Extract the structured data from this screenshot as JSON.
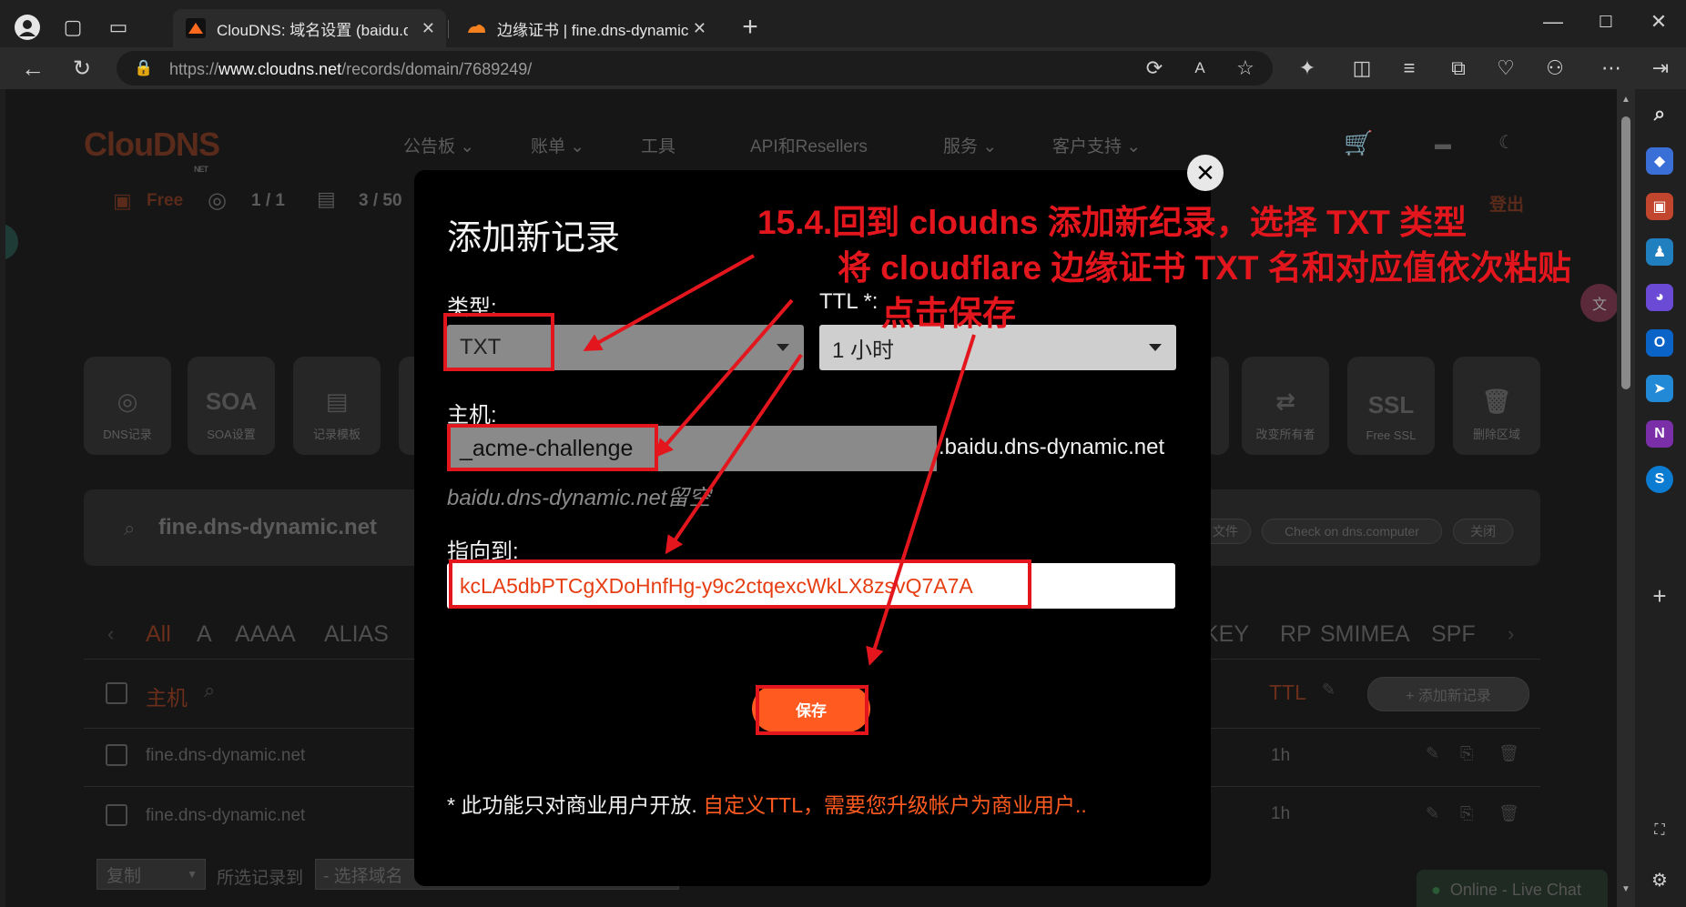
{
  "browser": {
    "tabs": [
      {
        "title": "ClouDNS: 域名设置 (baidu.dns-d",
        "close": "✕"
      },
      {
        "title": "边缘证书 | fine.dns-dynamic.net |",
        "close": "✕"
      }
    ],
    "new_tab": "+",
    "url": {
      "scheme": "https://",
      "host": "www.cloudns.net",
      "path": "/records/domain/7689249/"
    },
    "window_controls": {
      "minimize": "—",
      "maximize": "☐",
      "close": "✕"
    }
  },
  "site": {
    "logo": "ClouDNS",
    "logo_sub": "NET",
    "nav": [
      "公告板 ⌄",
      "账单 ⌄",
      "工具",
      "API和Resellers",
      "服务 ⌄",
      "客户支持 ⌄"
    ],
    "stats": {
      "plan": "Free",
      "zones": "1 / 1",
      "records": "3 / 50",
      "logout": "登出"
    },
    "tiles_left": [
      {
        "icon": "◎",
        "label": "DNS记录"
      },
      {
        "icon": "SOA",
        "label": "SOA设置"
      },
      {
        "icon": "▤",
        "label": "记录模板"
      }
    ],
    "tiles_right": [
      {
        "icon": "⇄",
        "label": "改变所有者"
      },
      {
        "icon": "SSL",
        "label": "Free SSL"
      },
      {
        "icon": "🗑",
        "label": "删除区域"
      }
    ],
    "search_domain": "fine.dns-dynamic.net",
    "search_actions": [
      "文件",
      "Check on dns.computer",
      "关闭"
    ],
    "types_left": [
      "All",
      "A",
      "AAAA",
      "ALIAS"
    ],
    "types_right": [
      "KEY",
      "RP",
      "SMIMEA",
      "SPF"
    ],
    "table": {
      "host_header": "主机",
      "ttl_header": "TTL",
      "add_button": "+ 添加新记录",
      "rows": [
        {
          "host": "fine.dns-dynamic.net",
          "ttl": "1h"
        },
        {
          "host": "fine.dns-dynamic.net",
          "ttl": "1h"
        }
      ]
    },
    "bulk": {
      "action": "复制",
      "label": "所选记录到",
      "placeholder": "- 选择域名"
    },
    "chat": "Online - Live Chat"
  },
  "modal": {
    "title": "添加新记录",
    "type_label": "类型:",
    "type_value": "TXT",
    "ttl_label": "TTL *:",
    "ttl_value": "1 小时",
    "host_label": "主机:",
    "host_value": "_acme-challenge",
    "host_suffix": ".baidu.dns-dynamic.net",
    "host_hint": "baidu.dns-dynamic.net留空",
    "value_label": "指向到:",
    "value_value": "kcLA5dbPTCgXDoHnfHg-y9c2ctqexcWkLX8zsvQ7A7A",
    "save_label": "保存",
    "note_prefix": "* 此功能只对商业用户开放.",
    "note_warn": "自定义TTL，需要您升级帐户为商业用户..",
    "close": "✕"
  },
  "annotations": {
    "line1": "15.4.回到 cloudns 添加新纪录，选择 TXT 类型",
    "line2": "将 cloudflare 边缘证书 TXT 名和对应值依次粘贴",
    "line3": "点击保存",
    "color": "#e3161e"
  },
  "colors": {
    "accent": "#ff5a1f",
    "annotation": "#e3161e",
    "modal_bg": "#000000"
  }
}
